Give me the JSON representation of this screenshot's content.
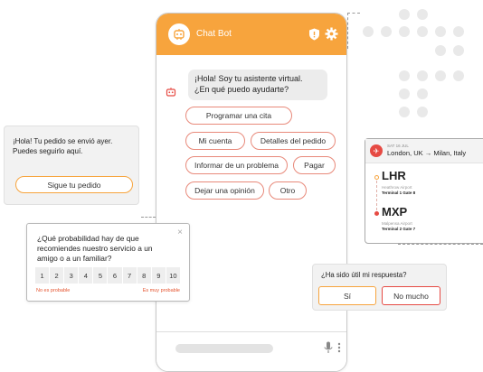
{
  "colors": {
    "accent_orange": "#f7a43d",
    "accent_red": "#e64a43",
    "option_border": "#e8897a",
    "bubble_gray": "#ececec"
  },
  "chat": {
    "title": "Chat Bot",
    "bot_message_line1": "¡Hola! Soy tu asistente virtual.",
    "bot_message_line2": "¿En qué puedo ayudarte?",
    "options": {
      "schedule": "Programar una cita",
      "account": "Mi cuenta",
      "order_details": "Detalles del pedido",
      "report": "Informar de un problema",
      "pay": "Pagar",
      "review": "Dejar una opinión",
      "other": "Otro"
    },
    "icons": {
      "avatar": "robot-icon",
      "shield": "shield-icon",
      "settings": "gear-icon",
      "mic": "microphone-icon",
      "more": "more-vertical-icon"
    }
  },
  "order": {
    "line1": "¡Hola! Tu pedido se envió ayer.",
    "line2": "Puedes seguirlo aquí.",
    "button": "Sigue tu pedido"
  },
  "survey": {
    "close": "×",
    "question": "¿Qué probabilidad hay de que recomiendes nuestro servicio a un amigo o a un familiar?",
    "scale": [
      "1",
      "2",
      "3",
      "4",
      "5",
      "6",
      "7",
      "8",
      "9",
      "10"
    ],
    "low_label": "No es probable",
    "high_label": "Es muy probable"
  },
  "flight": {
    "date": "SAT 16 JUL",
    "route_from": "London, UK",
    "arrow": "→",
    "route_to": "Milan, Italy",
    "origin": {
      "code": "LHR",
      "name": "Heathrow Airport",
      "gate": "Terminal 1 Gate 8"
    },
    "destination": {
      "code": "MXP",
      "name": "Malpensa Airport",
      "gate": "Terminal 2 Gate 7"
    }
  },
  "feedback": {
    "question": "¿Ha sido útil mi respuesta?",
    "yes": "Sí",
    "no": "No mucho"
  }
}
